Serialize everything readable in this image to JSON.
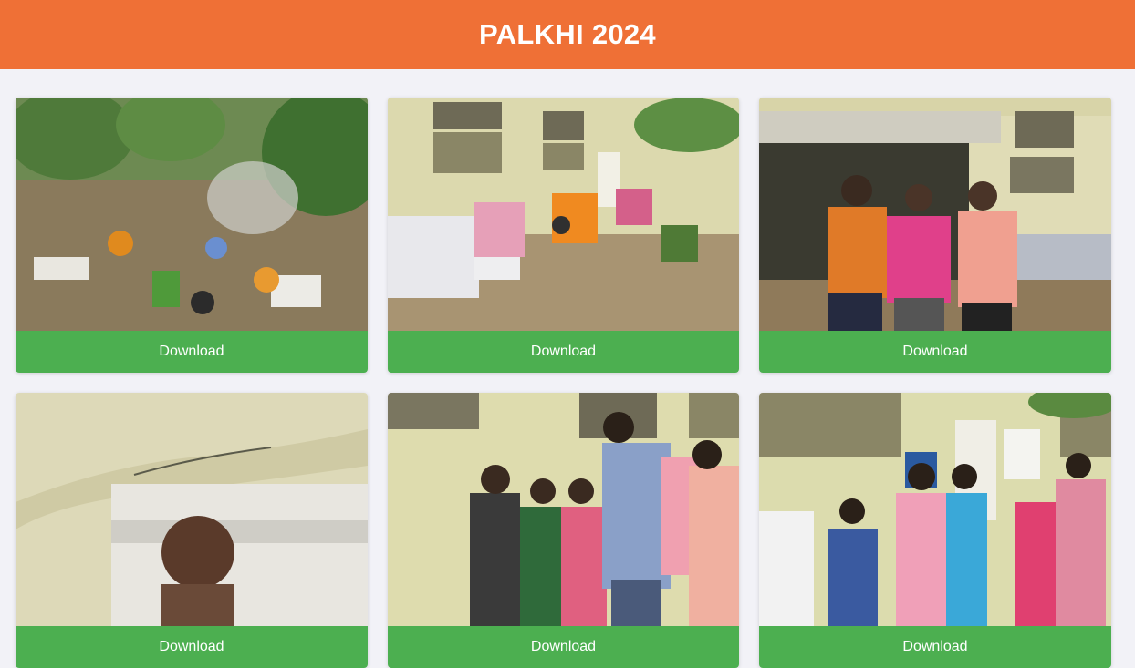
{
  "header": {
    "title": "PALKHI 2024",
    "color": "#ef7036"
  },
  "gallery": {
    "button_color": "#4caf50",
    "items": [
      {
        "photo": "photo-garden-cooking",
        "download_label": "Download"
      },
      {
        "photo": "photo-people-seated-courtyard",
        "download_label": "Download"
      },
      {
        "photo": "photo-three-men-standing",
        "download_label": "Download"
      },
      {
        "photo": "photo-man-portrait-wall",
        "download_label": "Download"
      },
      {
        "photo": "photo-women-seated-greeting",
        "download_label": "Download"
      },
      {
        "photo": "photo-women-group-building",
        "download_label": "Download"
      }
    ]
  }
}
